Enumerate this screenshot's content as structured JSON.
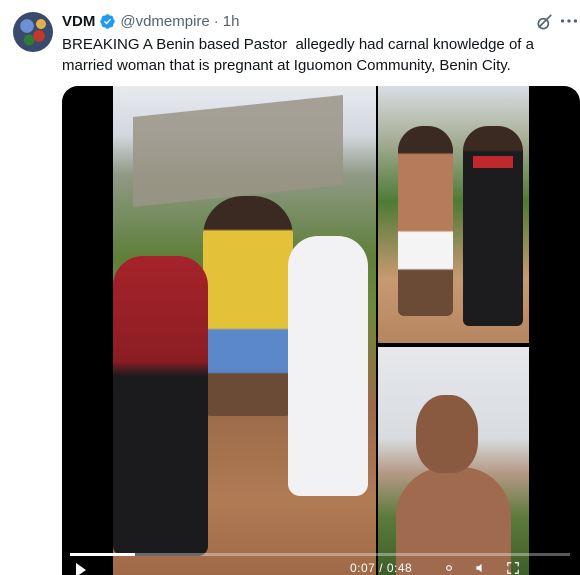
{
  "tweet": {
    "author_name": "VDM",
    "handle": "@vdmempire",
    "separator": "·",
    "time": "1h",
    "text": "BREAKING A Benin based Pastor  allegedly had carnal knowledge of a married woman that is pregnant at Iguomon Community, Benin City."
  },
  "icons": {
    "avatar": "avatar",
    "verified": "verified-badge-icon",
    "grok": "grok-icon",
    "more": "more-icon",
    "play": "play-icon"
  },
  "video": {
    "progress": 0.13,
    "time_readout": "0:07 / 0:48"
  },
  "colors": {
    "verified_blue": "#1d9bf0",
    "muted_text": "#536471",
    "primary_text": "#0f1419"
  }
}
